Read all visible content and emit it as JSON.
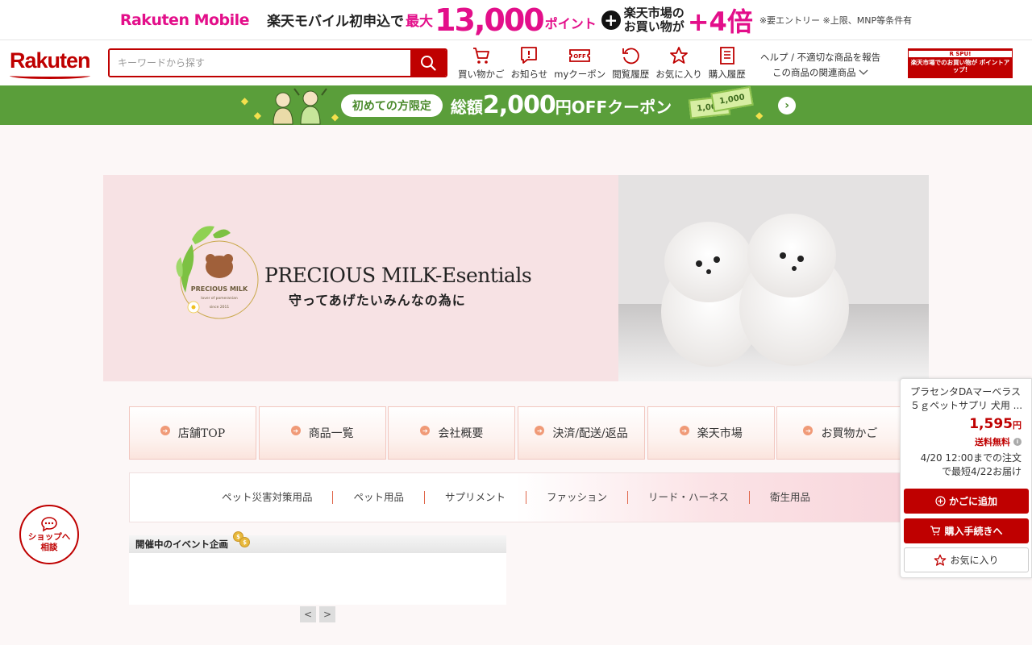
{
  "promo": {
    "brand": "Rakuten Mobile",
    "text1": "楽天モバイル初申込で",
    "text2": "最大",
    "points": "13,000",
    "points_unit": "ポイント",
    "plus": "+",
    "ichiba_line1": "楽天市場の",
    "ichiba_line2": "お買い物が",
    "multiplier": "+4倍",
    "note": "※要エントリー ※上限、MNP等条件有"
  },
  "header": {
    "logo": "Rakuten",
    "search_placeholder": "キーワードから探す",
    "nav": [
      {
        "label": "買い物かご",
        "icon": "cart-icon"
      },
      {
        "label": "お知らせ",
        "icon": "notification-icon"
      },
      {
        "label": "myクーポン",
        "icon": "coupon-icon"
      },
      {
        "label": "閲覧履歴",
        "icon": "history-icon"
      },
      {
        "label": "お気に入り",
        "icon": "star-icon"
      },
      {
        "label": "購入履歴",
        "icon": "receipt-icon"
      }
    ],
    "help_line1": "ヘルプ / 不適切な商品を報告",
    "help_line2": "この商品の関連商品",
    "spu_top": "R SPU!",
    "spu_text": "楽天市場でのお買い物が ポイントアップ!"
  },
  "coupon_banner": {
    "pill": "初めての方限定",
    "text_prefix": "総額",
    "amount": "2,000",
    "text_suffix": "円OFFクーポン",
    "bill1": "1,000",
    "bill2": "1,000"
  },
  "shop_banner": {
    "emblem_name": "PRECIOUS MILK",
    "emblem_sub": "lover of pomeranian",
    "emblem_since": "since 2011",
    "title": "PRECIOUS MILK-Esentials",
    "tagline": "守ってあげたいみんなの為に"
  },
  "shop_nav": [
    {
      "label": "店舗TOP"
    },
    {
      "label": "商品一覧"
    },
    {
      "label": "会社概要"
    },
    {
      "label": "決済/配送/返品"
    },
    {
      "label": "楽天市場"
    },
    {
      "label": "お買物かご"
    }
  ],
  "categories": [
    "ペット災害対策用品",
    "ペット用品",
    "サプリメント",
    "ファッション",
    "リード・ハーネス",
    "衛生用品"
  ],
  "event": {
    "heading": "開催中のイベント企画",
    "prev": "<",
    "next": ">"
  },
  "widget": {
    "product_name": "プラセンタDAマーベラス５ｇペットサプリ 犬用 ...",
    "price": "1,595",
    "price_unit": "円",
    "shipping": "送料無料",
    "delivery_line1": "4/20 12:00までの注文",
    "delivery_line2": "で最短4/22お届け",
    "add_to_cart": "かごに追加",
    "checkout": "購入手続きへ",
    "favorite": "お気に入り"
  },
  "chat": {
    "line1": "ショップへ",
    "line2": "相談"
  },
  "colors": {
    "rakuten_red": "#bf0000",
    "mobile_pink": "#e30f8a",
    "coupon_green": "#5a9e3a",
    "banner_pink": "#f7e2e4"
  }
}
